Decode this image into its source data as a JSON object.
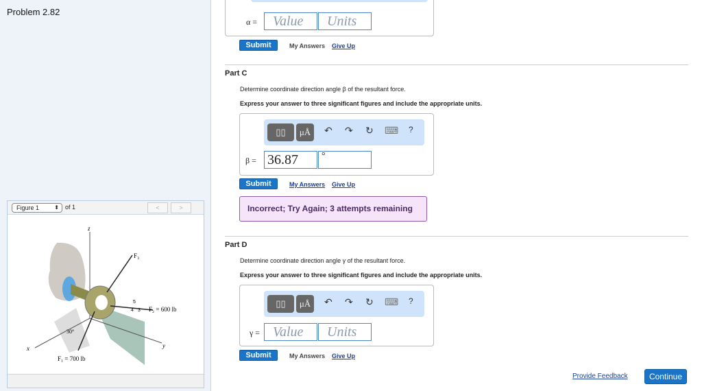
{
  "problem_title": "Problem 2.82",
  "figure": {
    "selector": "Figure 1",
    "of": "of 1",
    "prev": "<",
    "next": ">",
    "labels": {
      "z": "z",
      "x": "x",
      "y": "y",
      "f3": "F₃",
      "f2": "F₂ = 600 lb",
      "f1": "F₁ = 700 lb",
      "angle": "30°",
      "five": "5",
      "four": "4",
      "three": "3"
    }
  },
  "toolbar": {
    "templates": "▯▯",
    "units": "μÅ",
    "undo": "↶",
    "redo": "↷",
    "reset": "↻",
    "keyboard": "⌨",
    "help": "?"
  },
  "part_b": {
    "symbol": "α =",
    "value_placeholder": "Value",
    "units_placeholder": "Units",
    "submit": "Submit",
    "my_answers": "My Answers",
    "give_up": "Give Up"
  },
  "part_c": {
    "title": "Part C",
    "question": "Determine coordinate direction angle β of the resultant force.",
    "instruction": "Express your answer to three significant figures and include the appropriate units.",
    "symbol": "β =",
    "value": "36.87",
    "units": "°",
    "submit": "Submit",
    "my_answers": "My Answers",
    "give_up": "Give Up",
    "feedback": "Incorrect; Try Again; 3 attempts remaining"
  },
  "part_d": {
    "title": "Part D",
    "question": "Determine coordinate direction angle γ of the resultant force.",
    "instruction": "Express your answer to three significant figures and include the appropriate units.",
    "symbol": "γ =",
    "value_placeholder": "Value",
    "units_placeholder": "Units",
    "submit": "Submit",
    "my_answers": "My Answers",
    "give_up": "Give Up"
  },
  "footer": {
    "feedback": "Provide Feedback",
    "continue": "Continue"
  }
}
